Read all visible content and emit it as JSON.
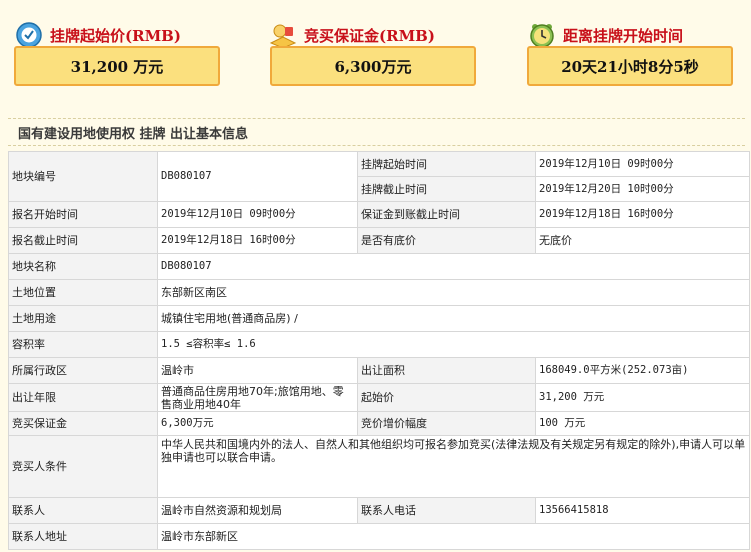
{
  "summary": {
    "start_price": {
      "label": "挂牌起始价(RMB)",
      "value": "31,200 万元",
      "icon": "money-icon"
    },
    "deposit": {
      "label": "竞买保证金(RMB)",
      "value": "6,300万元",
      "icon": "gold-icon"
    },
    "countdown": {
      "label": "距离挂牌开始时间",
      "value": "20天21小时8分5秒",
      "icon": "alarm-clock-icon"
    }
  },
  "section_title": "国有建设用地使用权 挂牌 出让基本信息",
  "info": {
    "parcel_no_label": "地块编号",
    "parcel_no": "DB080107",
    "listing_start_label": "挂牌起始时间",
    "listing_start": "2019年12月10日 09时00分",
    "listing_end_label": "挂牌截止时间",
    "listing_end": "2019年12月20日 10时00分",
    "reg_start_label": "报名开始时间",
    "reg_start": "2019年12月10日 09时00分",
    "deposit_deadline_label": "保证金到账截止时间",
    "deposit_deadline": "2019年12月18日 16时00分",
    "reg_end_label": "报名截止时间",
    "reg_end": "2019年12月18日 16时00分",
    "reserve_label": "是否有底价",
    "reserve": "无底价",
    "parcel_name_label": "地块名称",
    "parcel_name": "DB080107",
    "location_label": "土地位置",
    "location": "东部新区南区",
    "usage_label": "土地用途",
    "usage": "城镇住宅用地(普通商品房) /",
    "plot_ratio_label": "容积率",
    "plot_ratio": "1.5 ≤容积率≤ 1.6",
    "district_label": "所属行政区",
    "district": "温岭市",
    "area_label": "出让面积",
    "area": "168049.0平方米(252.073亩)",
    "term_label": "出让年限",
    "term": "普通商品住房用地70年;旅馆用地、零售商业用地40年",
    "start_price_label": "起始价",
    "start_price": "31,200 万元",
    "bid_deposit_label": "竞买保证金",
    "bid_deposit": "6,300万元",
    "increment_label": "竞价增价幅度",
    "increment": "100 万元",
    "bidder_label": "竞买人条件",
    "bidder": "中华人民共和国境内外的法人、自然人和其他组织均可报名参加竞买(法律法规及有关规定另有规定的除外),申请人可以单独申请也可以联合申请。",
    "contact_label": "联系人",
    "contact": "温岭市自然资源和规划局",
    "phone_label": "联系人电话",
    "phone": "13566415818",
    "address_label": "联系人地址",
    "address": "温岭市东部新区"
  }
}
